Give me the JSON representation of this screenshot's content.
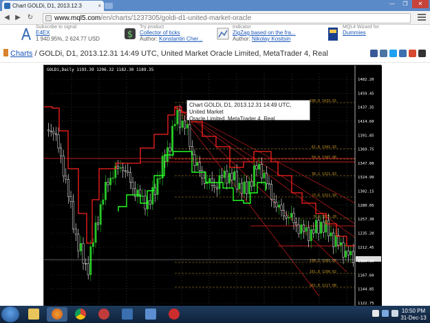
{
  "browser": {
    "tab_title": "Chart GOLDi, D1, 2013.12.3",
    "tab_close": "×",
    "window_buttons": [
      "—",
      "❐",
      "✕"
    ],
    "url_host": "www.mql5.com",
    "url_path": "/en/charts/1237305/goldi-d1-united-market-oracle"
  },
  "promos": [
    {
      "caption": "Subscribe to signal",
      "link": "E4EX",
      "meta": "1 940.95%, 2 624.77 USD"
    },
    {
      "caption": "Try product",
      "link": "Collector of ticks",
      "meta_prefix": "Author: ",
      "meta_link": "Konstantin Cher..."
    },
    {
      "caption": "Indicator",
      "link": "ZigZag based on the fra...",
      "meta_prefix": "Author: ",
      "meta_link": "Nikolay Kositsin"
    },
    {
      "caption": "MQL4 Wizard for",
      "link": "Dummies",
      "meta": ""
    }
  ],
  "breadcrumb": {
    "root": "Charts",
    "rest": " / GOLDi, D1, 2013.12.31 14:49 UTC, United Market Oracle Limited, MetaTrader 4, Real"
  },
  "chart": {
    "header_text": "GOLDi,Daily  1193.39 1206.32 1182.30 1189.35",
    "tooltip_line1": "Chart GOLDi, D1, 2013.12.31 14:49 UTC, United Market",
    "tooltip_line2": "Oracle Limited, MetaTrader 4, Real",
    "price_labels": [
      "1482.20",
      "1459.45",
      "1437.35",
      "1414.60",
      "1391.85",
      "1369.75",
      "1347.00",
      "1324.90",
      "1302.15",
      "1280.05",
      "1257.30",
      "1235.20",
      "1212.45",
      "1189.35",
      "1167.60",
      "1144.85",
      "1122.75"
    ],
    "fib_labels": [
      "100.0 1433.55",
      "61.8 1341.93",
      "50.0 1347.80",
      "38.2 1321.83",
      "23.6 1311.50",
      "0.0 1275.20",
      "138.2 1181.86",
      "161.8 1160.02",
      "261.8 1117.08"
    ],
    "colors": {
      "candle_up": "#28c828",
      "candle_down": "#ffffff",
      "resistance": "#ff2020",
      "support": "#22ff22",
      "fib": "#c89a28"
    }
  },
  "taskbar": {
    "clock_time": "10:50 PM",
    "clock_date": "31-Dec-13"
  }
}
